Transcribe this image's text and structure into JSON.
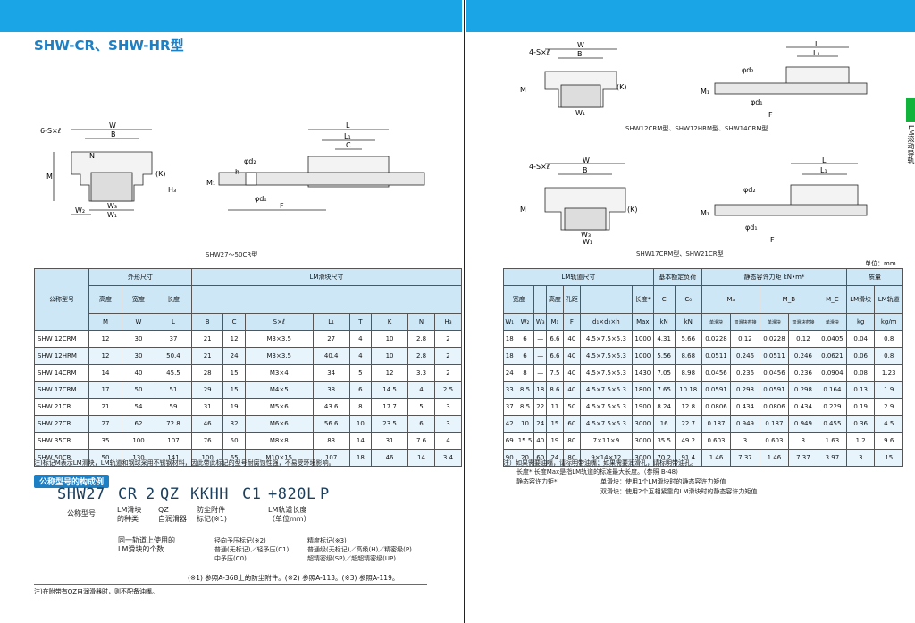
{
  "title": "SHW-CR、SHW-HR型",
  "side_tab": "LM滚动导轨",
  "unit": "单位：mm",
  "captions": {
    "left_diagram": "SHW27～50CR型",
    "right_top": "SHW12CRM型、SHW12HRM型、SHW14CRM型",
    "right_bottom": "SHW17CRM型、SHW21CR型"
  },
  "diagram_labels": {
    "S": "6-S×ℓ",
    "S4": "4-S×ℓ",
    "W": "W",
    "B": "B",
    "N": "N",
    "M": "M",
    "T": "T",
    "K": "(K)",
    "H3": "H₃",
    "W2": "W₂",
    "W1": "W₁",
    "W3": "W₃",
    "L": "L",
    "L1": "L₁",
    "C": "C",
    "d2": "φd₂",
    "d1": "φd₁",
    "h": "h",
    "M1": "M₁",
    "F": "F"
  },
  "left_table": {
    "headers": {
      "model": "公称型号",
      "outer": "外形尺寸",
      "block": "LM滑块尺寸",
      "height": "高度",
      "width": "宽度",
      "length": "长度",
      "cols": [
        "M",
        "W",
        "L",
        "B",
        "C",
        "S×ℓ",
        "L₁",
        "T",
        "K",
        "N",
        "H₃"
      ]
    },
    "rows": [
      [
        "SHW 12CRM",
        "12",
        "30",
        "37",
        "21",
        "12",
        "M3×3.5",
        "27",
        "4",
        "10",
        "2.8",
        "2"
      ],
      [
        "SHW 12HRM",
        "12",
        "30",
        "50.4",
        "21",
        "24",
        "M3×3.5",
        "40.4",
        "4",
        "10",
        "2.8",
        "2"
      ],
      [
        "SHW 14CRM",
        "14",
        "40",
        "45.5",
        "28",
        "15",
        "M3×4",
        "34",
        "5",
        "12",
        "3.3",
        "2"
      ],
      [
        "SHW 17CRM",
        "17",
        "50",
        "51",
        "29",
        "15",
        "M4×5",
        "38",
        "6",
        "14.5",
        "4",
        "2.5"
      ],
      [
        "SHW 21CR",
        "21",
        "54",
        "59",
        "31",
        "19",
        "M5×6",
        "43.6",
        "8",
        "17.7",
        "5",
        "3"
      ],
      [
        "SHW 27CR",
        "27",
        "62",
        "72.8",
        "46",
        "32",
        "M6×6",
        "56.6",
        "10",
        "23.5",
        "6",
        "3"
      ],
      [
        "SHW 35CR",
        "35",
        "100",
        "107",
        "76",
        "50",
        "M8×8",
        "83",
        "14",
        "31",
        "7.6",
        "4"
      ],
      [
        "SHW 50CR",
        "50",
        "130",
        "141",
        "100",
        "65",
        "M10×15",
        "107",
        "18",
        "46",
        "14",
        "3.4"
      ]
    ]
  },
  "right_table": {
    "headers": {
      "rail": "LM轨道尺寸",
      "load": "基本额定负荷",
      "moment": "静态容许力矩 kN•m*",
      "mass": "质量",
      "width": "宽度",
      "height": "高度",
      "pitch": "孔距",
      "length": "长度*",
      "cols": [
        "W₁",
        "W₂",
        "W₃",
        "M₁",
        "F",
        "d₁×d₂×h",
        "Max",
        "C",
        "C₀"
      ],
      "units": [
        "kN",
        "kN"
      ],
      "moment_groups": [
        "Mₐ",
        "M_B",
        "M_C"
      ],
      "moment_sub": [
        "单滑块",
        "双滑块密接",
        "单滑块",
        "双滑块密接",
        "单滑块"
      ],
      "mass_cols": [
        "LM滑块",
        "LM轨道"
      ],
      "mass_units": [
        "kg",
        "kg/m"
      ]
    },
    "rows": [
      [
        "18",
        "6",
        "—",
        "6.6",
        "40",
        "4.5×7.5×5.3",
        "1000",
        "4.31",
        "5.66",
        "0.0228",
        "0.12",
        "0.0228",
        "0.12",
        "0.0405",
        "0.04",
        "0.8"
      ],
      [
        "18",
        "6",
        "—",
        "6.6",
        "40",
        "4.5×7.5×5.3",
        "1000",
        "5.56",
        "8.68",
        "0.0511",
        "0.246",
        "0.0511",
        "0.246",
        "0.0621",
        "0.06",
        "0.8"
      ],
      [
        "24",
        "8",
        "—",
        "7.5",
        "40",
        "4.5×7.5×5.3",
        "1430",
        "7.05",
        "8.98",
        "0.0456",
        "0.236",
        "0.0456",
        "0.236",
        "0.0904",
        "0.08",
        "1.23"
      ],
      [
        "33",
        "8.5",
        "18",
        "8.6",
        "40",
        "4.5×7.5×5.3",
        "1800",
        "7.65",
        "10.18",
        "0.0591",
        "0.298",
        "0.0591",
        "0.298",
        "0.164",
        "0.13",
        "1.9"
      ],
      [
        "37",
        "8.5",
        "22",
        "11",
        "50",
        "4.5×7.5×5.3",
        "1900",
        "8.24",
        "12.8",
        "0.0806",
        "0.434",
        "0.0806",
        "0.434",
        "0.229",
        "0.19",
        "2.9"
      ],
      [
        "42",
        "10",
        "24",
        "15",
        "60",
        "4.5×7.5×5.3",
        "3000",
        "16",
        "22.7",
        "0.187",
        "0.949",
        "0.187",
        "0.949",
        "0.455",
        "0.36",
        "4.5"
      ],
      [
        "69",
        "15.5",
        "40",
        "19",
        "80",
        "7×11×9",
        "3000",
        "35.5",
        "49.2",
        "0.603",
        "3",
        "0.603",
        "3",
        "1.63",
        "1.2",
        "9.6"
      ],
      [
        "90",
        "20",
        "60",
        "24",
        "80",
        "9×14×12",
        "3000",
        "70.2",
        "91.4",
        "1.46",
        "7.37",
        "1.46",
        "7.37",
        "3.97",
        "3",
        "15"
      ]
    ]
  },
  "notes": {
    "left": "注)标记M表示LM滑块，LM轨道和钢球采用不锈钢材料，因此带此标记的型号耐腐蚀性强，不易受环境影响。",
    "right1": "注）如果需要油嘴，请标明带油嘴；如果需要润滑孔，请标明带油孔。",
    "right2": "长度*  长度Max是指LM轨道的标准最大长度。（参照 B-48）",
    "right3": "静态容许力矩*",
    "right4": "单滑块：使用1个LM滑块时的静态容许力矩值",
    "right5": "双滑块：使用2个互相紧靠的LM滑块时的静态容许力矩值"
  },
  "composition": {
    "label": "公称型号的构成例",
    "parts": [
      "SHW27",
      "CR",
      "2",
      "QZ",
      "KKHH",
      "C1",
      "+820L",
      "P"
    ],
    "desc": {
      "model": "公称型号",
      "block_type": "LM滑块\n的种类",
      "qz": "QZ\n自润滑器",
      "seal": "防尘附件\n标记(※1)",
      "rail_len": "LM轨道长度\n（单位mm）",
      "count": "同一轨道上使用的\nLM滑块的个数",
      "preload": "径向予压标记(※2)\n普通(无标记)／轻予压(C1)\n中予压(C0)",
      "accuracy": "精度标记(※3)\n普通级(无标记)／高级(H)／精密级(P)\n超精密级(SP)／超超精密级(UP)"
    },
    "refs": "(※1) 参照A-368上的防尘附件。(※2) 参照A-113。(※3) 参照A-119。",
    "bottom_note": "注)在附带有QZ自润滑器时，则不配备油嘴。"
  }
}
